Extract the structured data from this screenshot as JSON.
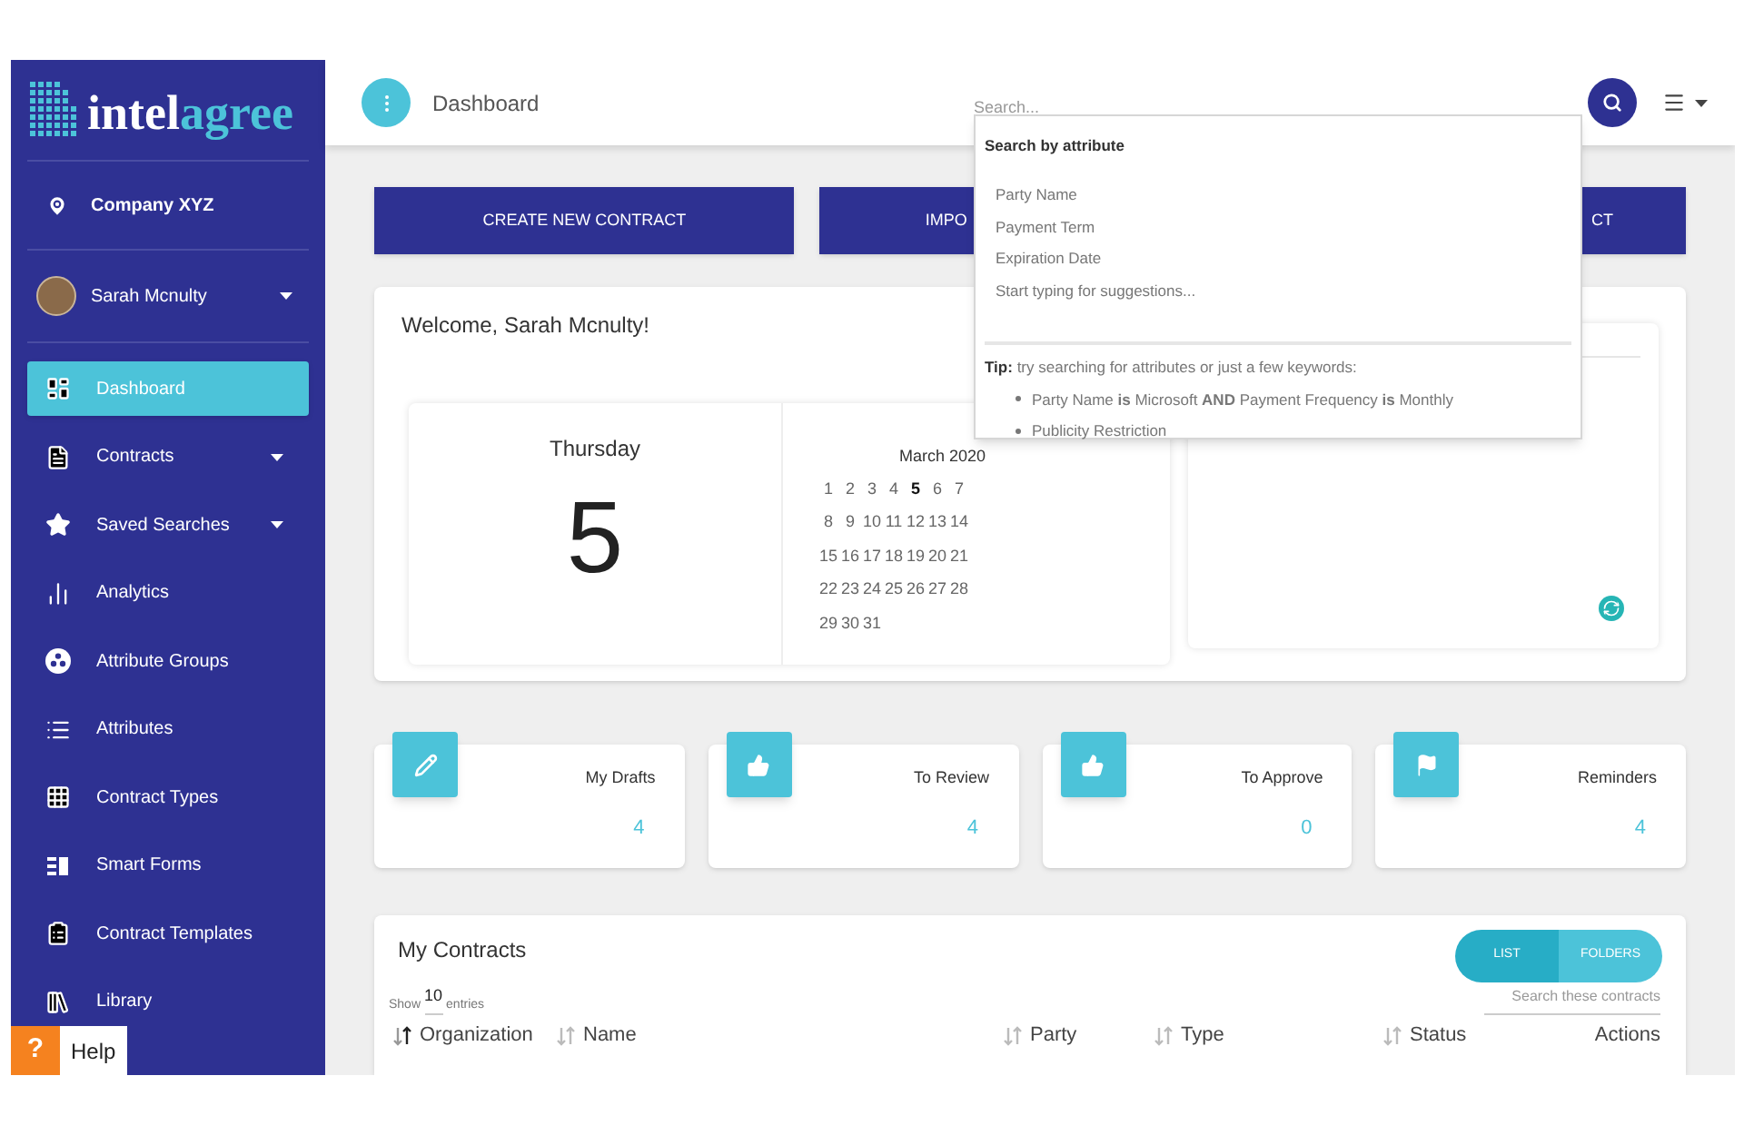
{
  "logo": {
    "first": "intel",
    "second": "agree"
  },
  "sidebar": {
    "company": "Company XYZ",
    "user": {
      "name": "Sarah Mcnulty",
      "expandable": true
    },
    "items": [
      {
        "label": "Dashboard",
        "selected": true,
        "expandable": false
      },
      {
        "label": "Contracts",
        "selected": false,
        "expandable": true
      },
      {
        "label": "Saved Searches",
        "selected": false,
        "expandable": true
      },
      {
        "label": "Analytics",
        "selected": false,
        "expandable": false
      },
      {
        "label": "Attribute Groups",
        "selected": false,
        "expandable": false
      },
      {
        "label": "Attributes",
        "selected": false,
        "expandable": false
      },
      {
        "label": "Contract Types",
        "selected": false,
        "expandable": false
      },
      {
        "label": "Smart Forms",
        "selected": false,
        "expandable": false
      },
      {
        "label": "Contract Templates",
        "selected": false,
        "expandable": false
      },
      {
        "label": "Library",
        "selected": false,
        "expandable": false
      }
    ]
  },
  "help": {
    "icon": "?",
    "label": "Help"
  },
  "header": {
    "title": "Dashboard",
    "search": {
      "placeholder": "Search..."
    }
  },
  "search_dropdown": {
    "heading": "Search by attribute",
    "suggestions": [
      "Party Name",
      "Payment Term",
      "Expiration Date",
      "Start typing for suggestions..."
    ],
    "tip_label": "Tip:",
    "tip": "try searching for attributes or just a few keywords:",
    "examples": [
      "Party Name **is** Microsoft **AND** Payment Frequency **is** Monthly",
      "Publicity Restriction"
    ]
  },
  "actions": [
    "CREATE NEW CONTRACT",
    "IMPO",
    "CT"
  ],
  "welcome": {
    "title": "Welcome, Sarah Mcnulty!",
    "weekday": "Thursday",
    "day": "5",
    "month": "March 2020",
    "weeks": [
      [
        {
          "d": "1",
          "today": false
        },
        {
          "d": "2",
          "today": false
        },
        {
          "d": "3",
          "today": false
        },
        {
          "d": "4",
          "today": false
        },
        {
          "d": "5",
          "today": true
        },
        {
          "d": "6",
          "today": false
        },
        {
          "d": "7",
          "today": false
        }
      ],
      [
        {
          "d": "8",
          "today": false
        },
        {
          "d": "9",
          "today": false
        },
        {
          "d": "10",
          "today": false
        },
        {
          "d": "11",
          "today": false
        },
        {
          "d": "12",
          "today": false
        },
        {
          "d": "13",
          "today": false
        },
        {
          "d": "14",
          "today": false
        }
      ],
      [
        {
          "d": "15",
          "today": false
        },
        {
          "d": "16",
          "today": false
        },
        {
          "d": "17",
          "today": false
        },
        {
          "d": "18",
          "today": false
        },
        {
          "d": "19",
          "today": false
        },
        {
          "d": "20",
          "today": false
        },
        {
          "d": "21",
          "today": false
        }
      ],
      [
        {
          "d": "22",
          "today": false
        },
        {
          "d": "23",
          "today": false
        },
        {
          "d": "24",
          "today": false
        },
        {
          "d": "25",
          "today": false
        },
        {
          "d": "26",
          "today": false
        },
        {
          "d": "27",
          "today": false
        },
        {
          "d": "28",
          "today": false
        }
      ],
      [
        {
          "d": "29",
          "today": false
        },
        {
          "d": "30",
          "today": false
        },
        {
          "d": "31",
          "today": false
        }
      ]
    ]
  },
  "stats": [
    {
      "kind": "pencil",
      "label": "My Drafts",
      "value": "4"
    },
    {
      "kind": "thumb",
      "label": "To Review",
      "value": "4"
    },
    {
      "kind": "thumb",
      "label": "To Approve",
      "value": "0"
    },
    {
      "kind": "flag",
      "label": "Reminders",
      "value": "4"
    }
  ],
  "contracts": {
    "title": "My Contracts",
    "views": [
      {
        "label": "LIST",
        "selected": true
      },
      {
        "label": "FOLDERS",
        "selected": false
      }
    ],
    "show": "Show",
    "entries_count": "10",
    "entries": "entries",
    "search": {
      "placeholder": "Search these contracts"
    },
    "columns": [
      {
        "label": "Organization",
        "sorted": true
      },
      {
        "label": "Name",
        "sorted": false
      },
      {
        "label": "Party",
        "sorted": false
      },
      {
        "label": "Type",
        "sorted": false
      },
      {
        "label": "Status",
        "sorted": false
      },
      {
        "label": "Actions"
      }
    ]
  }
}
